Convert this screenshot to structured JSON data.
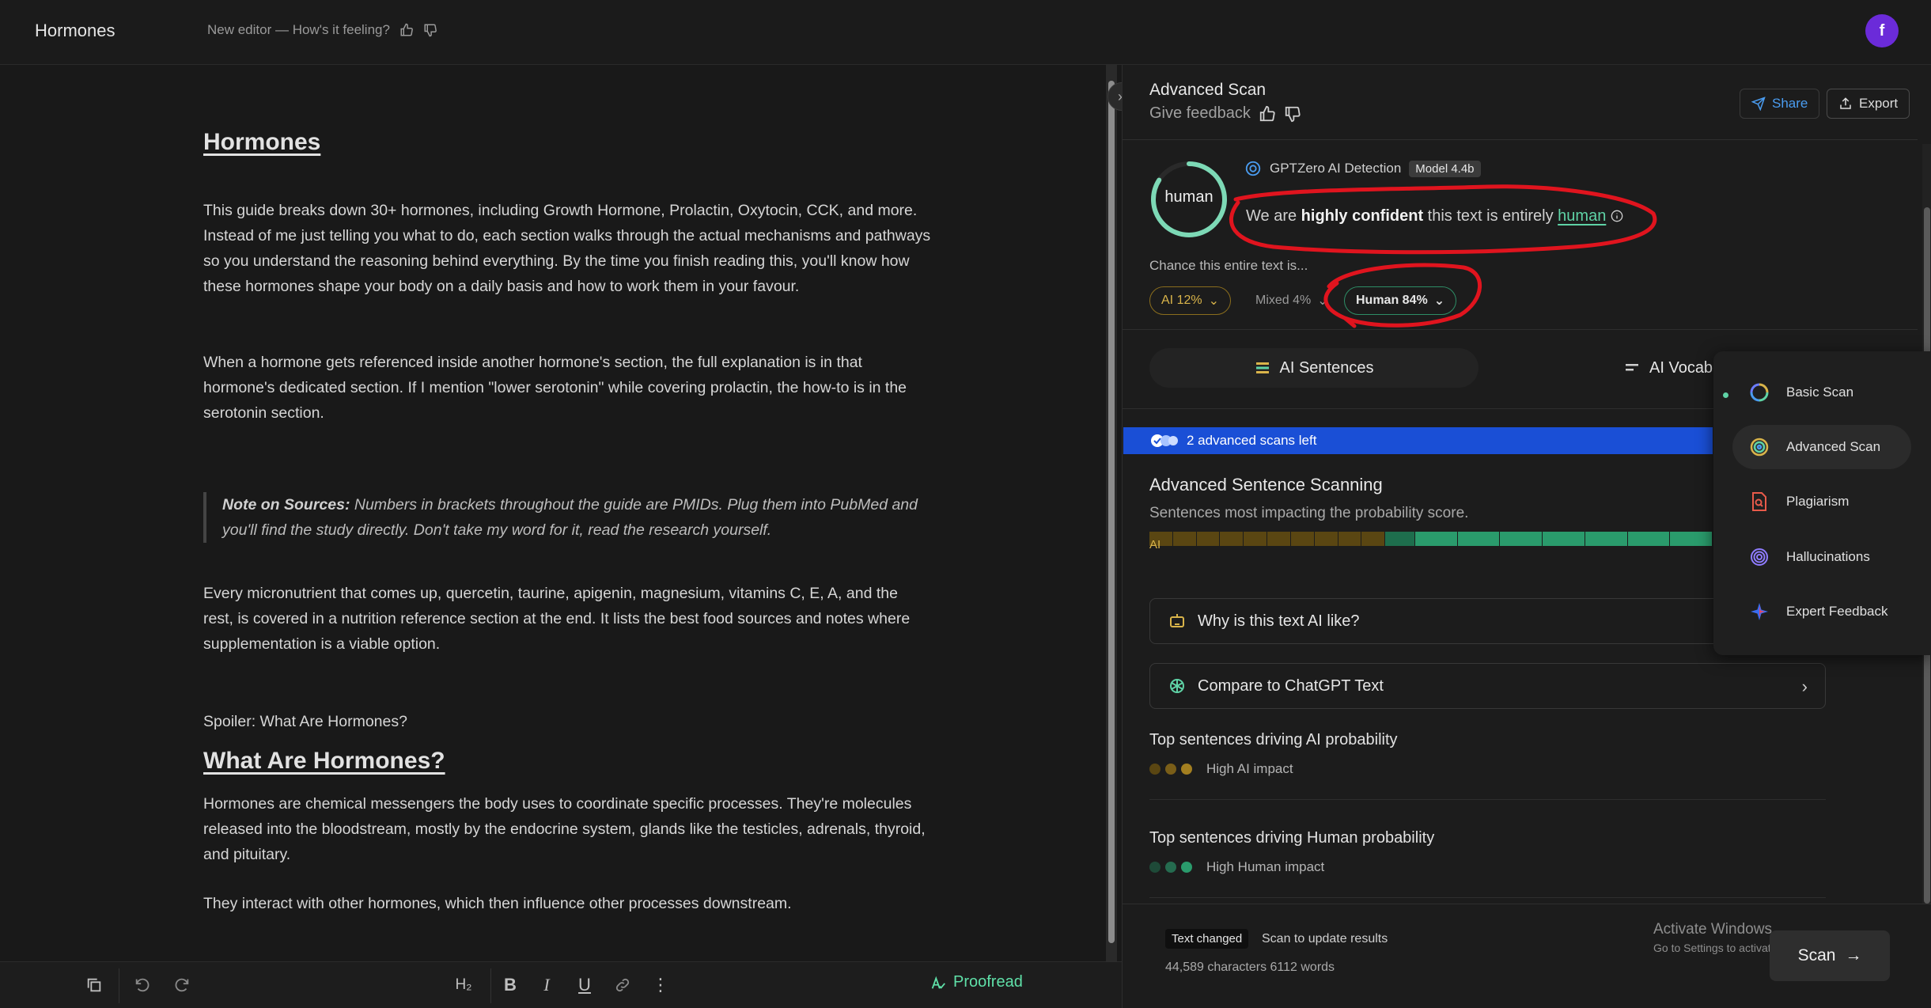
{
  "header": {
    "doc_title": "Hormones",
    "feedback_question": "New editor — How's it feeling?",
    "avatar_initial": "f"
  },
  "editor": {
    "h1": "Hormones",
    "p1": "This guide breaks down 30+ hormones, including Growth Hormone, Prolactin, Oxytocin, CCK, and more. Instead of me just telling you what to do, each section walks through the actual mechanisms and pathways so you understand the reasoning behind everything. By the time you finish reading this, you'll know how these hormones shape your body on a daily basis and how to work them in your favour.",
    "p2": "When a hormone gets referenced inside another hormone's section, the full explanation is in that hormone's dedicated section. If I mention \"lower serotonin\" while covering prolactin, the how-to is in the serotonin section.",
    "quote_bold": "Note on Sources:",
    "quote_text": " Numbers in brackets throughout the guide are PMIDs. Plug them into PubMed and you'll find the study directly. Don't take my word for it, read the research yourself.",
    "p3": "Every micronutrient that comes up, quercetin, taurine, apigenin, magnesium, vitamins C, E, A, and the rest, is covered in a nutrition reference section at the end. It lists the best food sources and notes where supplementation is a viable option.",
    "p4": "Spoiler: What Are Hormones?",
    "h2": "What Are Hormones?",
    "p5": "Hormones are chemical messengers the body uses to coordinate specific processes. They're molecules released into the bloodstream, mostly by the endocrine system, glands like the testicles, adrenals, thyroid, and pituitary.",
    "p6": "They interact with other hormones, which then influence other processes downstream."
  },
  "toolbar": {
    "heading_label": "H₂",
    "bold": "B",
    "italic": "I",
    "underline": "U",
    "more": "⋮",
    "proofread_label": "Proofread"
  },
  "panel": {
    "title": "Advanced Scan",
    "give_feedback": "Give feedback",
    "share_label": "Share",
    "export_label": "Export",
    "gauge_label": "human",
    "detection_label": "GPTZero AI Detection",
    "model_badge": "Model 4.4b",
    "verdict_pre": "We are ",
    "verdict_bold": "highly confident",
    "verdict_mid": " this text is entirely ",
    "verdict_hl": "human",
    "chance_label": "Chance this entire text is...",
    "pills": {
      "ai": "AI 12%",
      "mixed": "Mixed 4%",
      "human": "Human 84%"
    },
    "probabilities": {
      "ai": 12,
      "mixed": 4,
      "human": 84
    },
    "tabs": {
      "ai_sentences": "AI Sentences",
      "ai_vocab": "AI Vocab"
    },
    "scans_left": "2 advanced scans left",
    "adv_title": "Advanced Sentence Scanning",
    "adv_sub": "Sentences most impacting the probability score.",
    "bar_ai_label": "AI",
    "card_why": "Why is this text AI like?",
    "card_compare": "Compare to ChatGPT Text",
    "top_ai_title": "Top sentences driving AI probability",
    "top_ai_impact": "High AI impact",
    "top_human_title": "Top sentences driving Human probability",
    "top_human_impact": "High Human impact",
    "text_changed_badge": "Text changed",
    "text_changed_msg": "Scan to update results",
    "counts": "44,589 characters 6112 words",
    "scan_label": "Scan",
    "activate_line1": "Activate Windows",
    "activate_line2": "Go to Settings to activate Windows."
  },
  "menu": {
    "items": [
      {
        "label": "Basic Scan",
        "icon": "basic-scan-icon"
      },
      {
        "label": "Advanced Scan",
        "icon": "advanced-scan-icon"
      },
      {
        "label": "Plagiarism",
        "icon": "plagiarism-icon"
      },
      {
        "label": "Hallucinations",
        "icon": "hallucinations-icon"
      },
      {
        "label": "Expert Feedback",
        "icon": "expert-feedback-icon"
      }
    ]
  },
  "colors": {
    "accent_green": "#5fd3a6",
    "ai_gold": "#d9b44a",
    "banner_blue": "#1a4fd6",
    "avatar_purple": "#6b2bd9",
    "annotation_red": "#e0141e"
  }
}
